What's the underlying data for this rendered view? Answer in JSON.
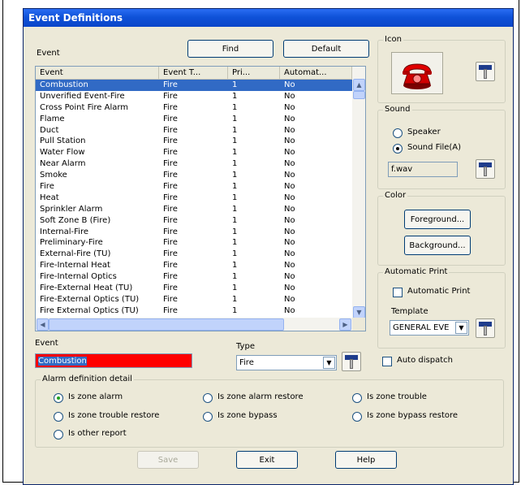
{
  "window": {
    "title": "Event Definitions"
  },
  "buttons": {
    "find": "Find",
    "default": "Default",
    "save": "Save",
    "exit": "Exit",
    "help": "Help"
  },
  "event_list": {
    "label": "Event",
    "columns": [
      "Event",
      "Event T...",
      "Pri...",
      "Automat..."
    ],
    "rows": [
      [
        "Combustion",
        "Fire",
        "1",
        "No"
      ],
      [
        "Unverified Event-Fire",
        "Fire",
        "1",
        "No"
      ],
      [
        "Cross Point Fire Alarm",
        "Fire",
        "1",
        "No"
      ],
      [
        "Flame",
        "Fire",
        "1",
        "No"
      ],
      [
        "Duct",
        "Fire",
        "1",
        "No"
      ],
      [
        "Pull Station",
        "Fire",
        "1",
        "No"
      ],
      [
        "Water Flow",
        "Fire",
        "1",
        "No"
      ],
      [
        "Near Alarm",
        "Fire",
        "1",
        "No"
      ],
      [
        "Smoke",
        "Fire",
        "1",
        "No"
      ],
      [
        "Fire",
        "Fire",
        "1",
        "No"
      ],
      [
        "Heat",
        "Fire",
        "1",
        "No"
      ],
      [
        "Sprinkler Alarm",
        "Fire",
        "1",
        "No"
      ],
      [
        "Soft Zone B (Fire)",
        "Fire",
        "1",
        "No"
      ],
      [
        "Internal-Fire",
        "Fire",
        "1",
        "No"
      ],
      [
        "Preliminary-Fire",
        "Fire",
        "1",
        "No"
      ],
      [
        "External-Fire (TU)",
        "Fire",
        "1",
        "No"
      ],
      [
        "Fire-Internal Heat",
        "Fire",
        "1",
        "No"
      ],
      [
        "Fire-Internal Optics",
        "Fire",
        "1",
        "No"
      ],
      [
        "Fire-External Heat (TU)",
        "Fire",
        "1",
        "No"
      ],
      [
        "Fire-External Optics (TU)",
        "Fire",
        "1",
        "No"
      ],
      [
        "Fire External Optics (TU)",
        "Fire",
        "1",
        "No"
      ]
    ],
    "selected_index": 0
  },
  "icon_group": {
    "title": "Icon",
    "icon": "red-telephone-icon"
  },
  "sound_group": {
    "title": "Sound",
    "options": [
      "Speaker",
      "Sound File(A)"
    ],
    "selected_index": 1,
    "file_value": "f.wav"
  },
  "color_group": {
    "title": "Color",
    "foreground": "Foreground...",
    "background": "Background..."
  },
  "print_group": {
    "title": "Automatic Print",
    "checkbox_label": "Automatic Print",
    "checked": false,
    "template_label": "Template",
    "template_value": "GENERAL EVE"
  },
  "event_field": {
    "label": "Event",
    "value": "Combustion",
    "highlight_color": "#ff0000"
  },
  "type_field": {
    "label": "Type",
    "value": "Fire"
  },
  "auto_dispatch": {
    "label": "Auto dispatch",
    "checked": false
  },
  "alarm_detail": {
    "title": "Alarm definition detail",
    "options": [
      "Is zone alarm",
      "Is zone alarm restore",
      "Is zone trouble",
      "Is zone trouble restore",
      "Is zone bypass",
      "Is zone bypass restore",
      "Is other report"
    ],
    "selected_index": 0
  },
  "colors": {
    "title_bar": "#0f52d8",
    "selection": "#316ac5",
    "dialog_bg": "#ece9d8"
  }
}
